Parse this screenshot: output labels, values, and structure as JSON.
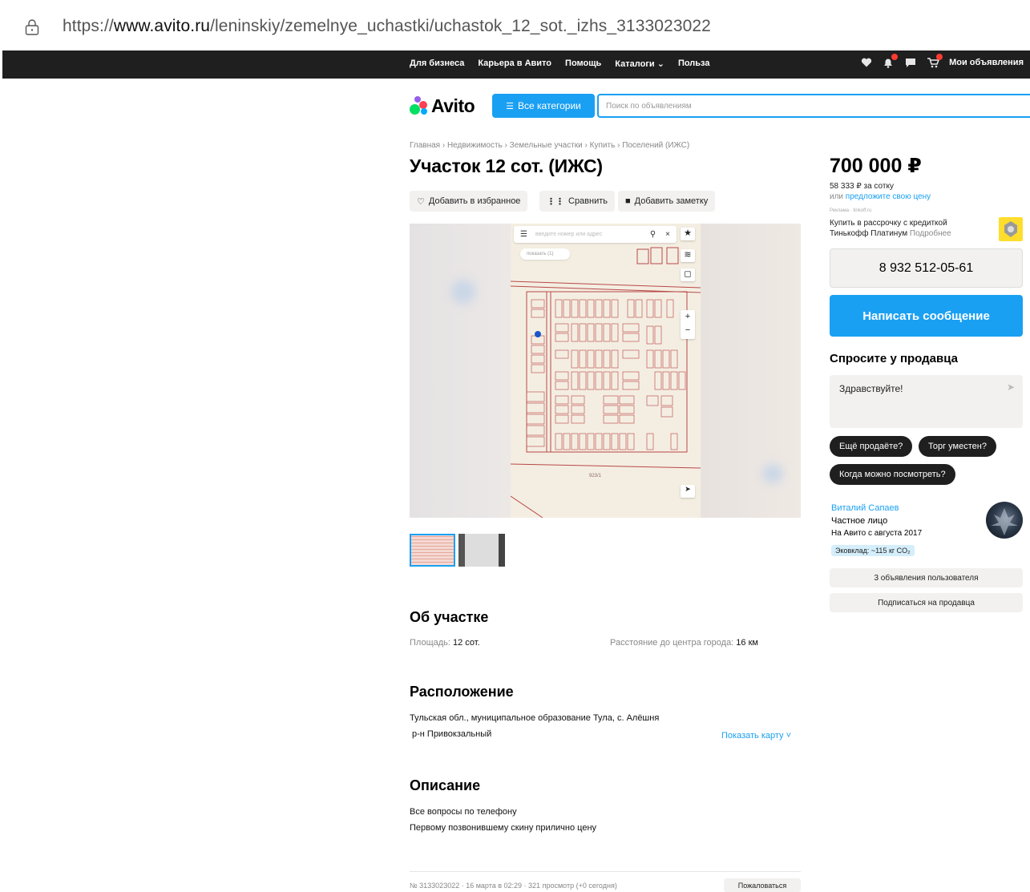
{
  "browser": {
    "url_prefix": "https://",
    "url_domain": "www.avito.ru",
    "url_path": "/leninskiy/zemelnye_uchastki/uchastok_12_sot._izhs_3133023022"
  },
  "topnav": {
    "links": [
      "Для бизнеса",
      "Карьера в Авито",
      "Помощь",
      "Каталоги",
      "Польза"
    ],
    "my_ads": "Мои объявления"
  },
  "header": {
    "logo": "Avito",
    "categories_button": "Все категории",
    "search_placeholder": "Поиск по объявлениям"
  },
  "breadcrumbs": [
    "Главная",
    "Недвижимость",
    "Земельные участки",
    "Купить",
    "Поселений (ИЖС)"
  ],
  "listing": {
    "title": "Участок 12 сот. (ИЖС)",
    "actions": {
      "favorite": "Добавить в избранное",
      "compare": "Сравнить",
      "note": "Добавить заметку"
    }
  },
  "map": {
    "search_placeholder": "введите номер или адрес",
    "show_label": "показать (1)",
    "zoom_in": "+",
    "zoom_out": "−",
    "plot_label": "923/1"
  },
  "about": {
    "heading": "Об участке",
    "area_label": "Площадь: ",
    "area_value": "12 сот.",
    "distance_label": "Расстояние до центра города: ",
    "distance_value": "16 км"
  },
  "location": {
    "heading": "Расположение",
    "address_line1": "Тульская обл., муниципальное образование Тула, с. Алёшня",
    "address_line2": "р-н Привокзальный",
    "show_map": "Показать карту"
  },
  "description": {
    "heading": "Описание",
    "line1": "Все вопросы по телефону",
    "line2": "Первому позвонившему скину прилично цену"
  },
  "footer": {
    "meta": "№ 3133023022 · 16 марта в 02:29 · 321 просмотр (+0 сегодня)",
    "report": "Пожаловаться"
  },
  "sidebar": {
    "price": "700 000 ₽",
    "price_per": "58 333 ₽ за сотку",
    "offer_prefix": "или ",
    "offer_link": "предложите свою цену",
    "ad_label": "Реклама · tinkoff.ru",
    "credit_line1": "Купить в рассрочку с кредиткой",
    "credit_line2": "Тинькофф Платинум",
    "credit_more": "Подробнее",
    "phone": "8 932 512-05-61",
    "message_button": "Написать сообщение",
    "ask_heading": "Спросите у продавца",
    "ask_placeholder": "Здравствуйте!",
    "chips": [
      "Ещё продаёте?",
      "Торг уместен?",
      "Когда можно посмотреть?"
    ],
    "seller_name": "Виталий Сапаев",
    "seller_type": "Частное лицо",
    "seller_since": "На Авито с августа 2017",
    "eco": "Эковклад: ~115 кг CO₂",
    "user_ads": "3 объявления пользователя",
    "subscribe": "Подписаться на продавца"
  },
  "colors": {
    "accent": "#1aa0f3",
    "dark": "#1f1f1f",
    "light_gray": "#f2f1f0"
  }
}
